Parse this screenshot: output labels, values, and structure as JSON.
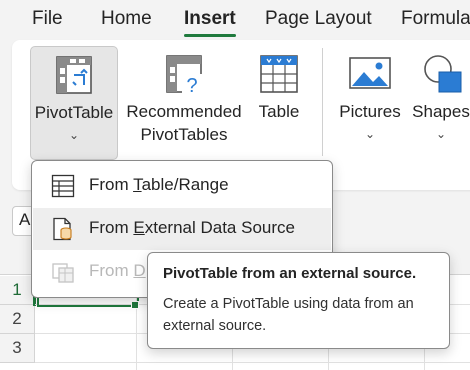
{
  "menu_tabs": [
    {
      "label": "File"
    },
    {
      "label": "Home"
    },
    {
      "label": "Insert",
      "active": true
    },
    {
      "label": "Page Layout"
    },
    {
      "label": "Formula"
    }
  ],
  "ribbon": {
    "pivot_table": {
      "label": "PivotTable",
      "icon": "pivot-table-icon"
    },
    "recommended": {
      "label_line1": "Recommended",
      "label_line2": "PivotTables",
      "icon": "recommended-pivot-icon"
    },
    "table": {
      "label": "Table",
      "icon": "table-icon"
    },
    "pictures": {
      "label": "Pictures",
      "icon": "picture-icon"
    },
    "shapes": {
      "label": "Shapes",
      "icon": "shapes-icon"
    }
  },
  "name_box": {
    "value": "A"
  },
  "dropdown": {
    "items": [
      {
        "prefix": "From ",
        "accel": "T",
        "suffix": "able/Range",
        "icon": "table-range-icon",
        "state": "normal"
      },
      {
        "prefix": "From ",
        "accel": "E",
        "suffix": "xternal Data Source",
        "icon": "external-data-icon",
        "state": "hover"
      },
      {
        "prefix": "From ",
        "accel": "D",
        "suffix": "",
        "icon": "data-model-icon",
        "state": "disabled"
      }
    ]
  },
  "tooltip": {
    "title": "PivotTable from an external source.",
    "body": "Create a PivotTable using data from an external source."
  },
  "rows": [
    "1",
    "2",
    "3"
  ],
  "colors": {
    "accent": "#1f7a3d",
    "hover": "#eeeeee"
  }
}
